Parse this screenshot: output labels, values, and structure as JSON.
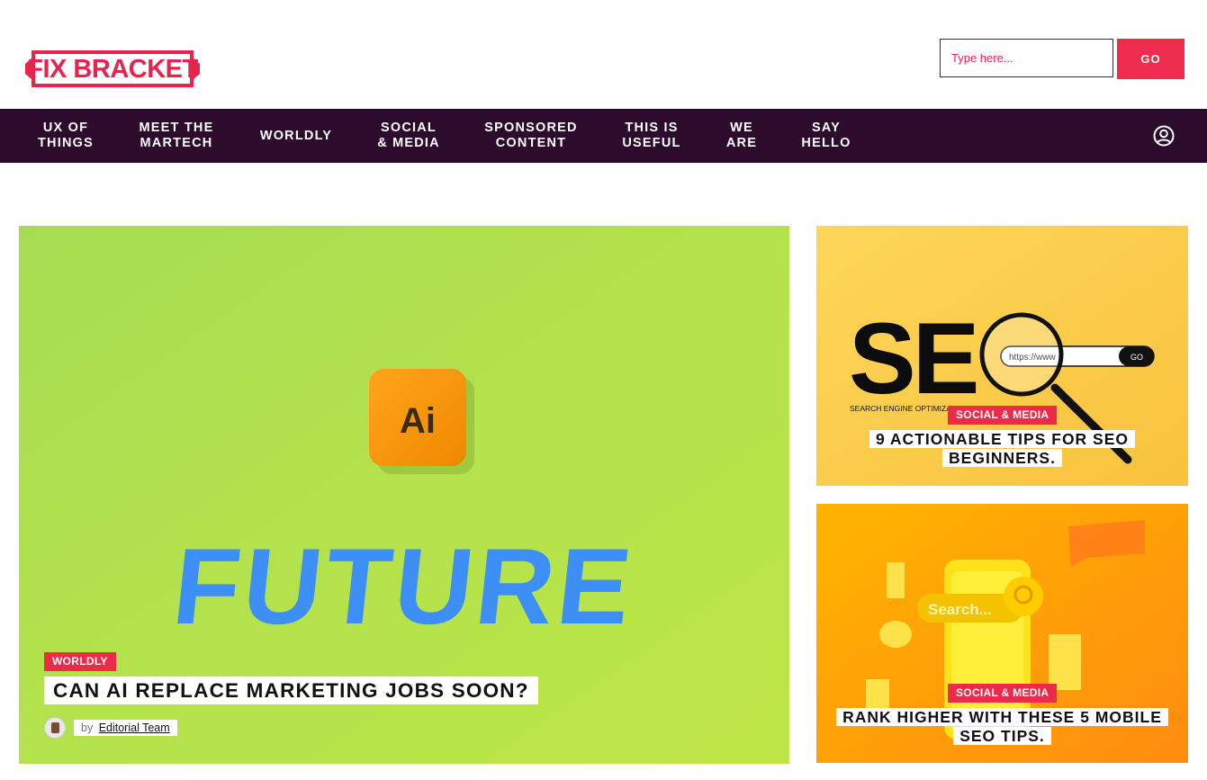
{
  "site": {
    "logo_text": "FIX BRACKET",
    "colors": {
      "brand": "#e6254f",
      "nav_bg": "#2d0b2d",
      "badge": "#ee2a4a"
    }
  },
  "search": {
    "placeholder": "Type here...",
    "button_label": "GO"
  },
  "nav": {
    "items": [
      {
        "label": "UX OF\nTHINGS"
      },
      {
        "label": "MEET THE\nMARTECH"
      },
      {
        "label": "WORLDLY"
      },
      {
        "label": "SOCIAL\n& MEDIA"
      },
      {
        "label": "SPONSORED\nCONTENT"
      },
      {
        "label": "THIS IS\nUSEFUL"
      },
      {
        "label": "WE\nARE"
      },
      {
        "label": "SAY\nHELLO"
      }
    ],
    "account_icon": "user-circle-icon"
  },
  "featured": {
    "category": "WORLDLY",
    "title": "CAN AI REPLACE MARKETING JOBS SOON?",
    "byline_prefix": "by",
    "author": "Editorial Team",
    "image_text": {
      "app_icon": "Ai",
      "word": "FUTURE"
    }
  },
  "side_posts": [
    {
      "category": "SOCIAL & MEDIA",
      "title_line1": "9 ACTIONABLE TIPS FOR SEO",
      "title_line2": "BEGINNERS.",
      "image_text": {
        "big": "SE",
        "caption": "SEARCH ENGINE OPTIMIZATION",
        "url": "https://www",
        "go": "GO"
      }
    },
    {
      "category": "SOCIAL & MEDIA",
      "title_line1": "RANK HIGHER WITH THESE 5 MOBILE",
      "title_line2": "SEO TIPS.",
      "image_text": {
        "search": "Search..."
      }
    }
  ]
}
